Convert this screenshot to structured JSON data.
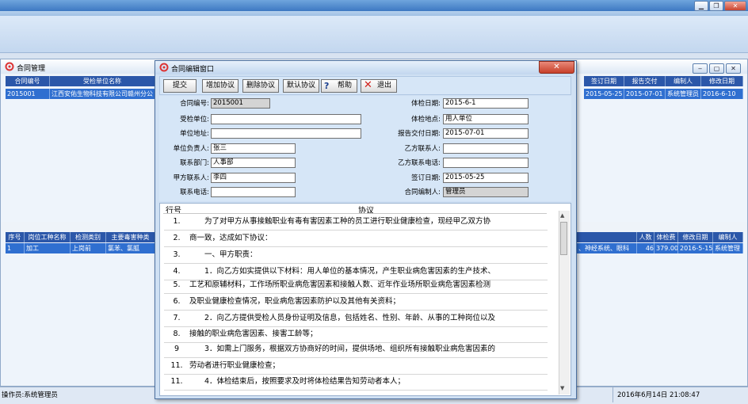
{
  "window": {
    "min": "▁",
    "restore": "❐",
    "close": "✕"
  },
  "main": {
    "title": "合同管理",
    "controls": {
      "min": "‒",
      "restore": "▢",
      "close": "✕"
    },
    "top_grid": {
      "headers": [
        "合同编号",
        "受检单位名称"
      ],
      "right_headers": [
        "签订日期",
        "报告交付",
        "编制人",
        "修改日期"
      ],
      "row": [
        "2015001",
        "江西安佑生物科技有限公司赣州分公"
      ],
      "right_row": [
        "2015-05-25",
        "2015-07-01",
        "系统管理员",
        "2016-6-10"
      ]
    },
    "bottom_grid": {
      "headers": [
        "序号",
        "岗位工种名称",
        "检测类别",
        "主要毒害种类"
      ],
      "right_headers": [
        "人数",
        "体检费",
        "修改日期",
        "编制人"
      ],
      "row": [
        "1",
        "加工",
        "上岗前",
        "氯苯、氯胍"
      ],
      "right_row": [
        "、神经系统、眼科",
        "46",
        "379.00",
        "2016-5-15",
        "系统管理"
      ]
    },
    "status": {
      "operator": "操作员:系统管理员",
      "datetime": "2016年6月14日 21:08:47"
    }
  },
  "dialog": {
    "title": "合同编辑窗口",
    "buttons": [
      "提交",
      "增加协议",
      "删除协议",
      "默认协议",
      "帮助",
      "退出"
    ],
    "form": {
      "contract_no": {
        "label": "合同编号:",
        "value": "2015001"
      },
      "unit": {
        "label": "受检单位:",
        "value": ""
      },
      "address": {
        "label": "单位地址:",
        "value": ""
      },
      "person": {
        "label": "单位负责人:",
        "value": "张三"
      },
      "dept": {
        "label": "联系部门:",
        "value": "人事部"
      },
      "a_contact": {
        "label": "甲方联系人:",
        "value": "李四"
      },
      "phone": {
        "label": "联系电话:",
        "value": ""
      },
      "exam_date": {
        "label": "体检日期:",
        "value": "2015-6-1"
      },
      "exam_place": {
        "label": "体检地点:",
        "value": "用人单位"
      },
      "report_date": {
        "label": "报告交付日期:",
        "value": "2015-07-01"
      },
      "b_contact": {
        "label": "乙方联系人:",
        "value": ""
      },
      "b_phone": {
        "label": "乙方联系电话:",
        "value": ""
      },
      "sign_date": {
        "label": "签订日期:",
        "value": "2015-05-25"
      },
      "author": {
        "label": "合同编制人:",
        "value": "管理员"
      }
    },
    "agreement": {
      "col_no": "行号",
      "col_text": "协议",
      "lines": [
        {
          "no": "1.",
          "text": "　　为了对甲方从事接触职业有毒有害因素工种的员工进行职业健康检查，现经甲乙双方协"
        },
        {
          "no": "2.",
          "text": "商一致，达成如下协议："
        },
        {
          "no": "3.",
          "text": "　　一、甲方职责："
        },
        {
          "no": "4.",
          "text": "　　1．向乙方如实提供以下材料：用人单位的基本情况，产生职业病危害因素的生产技术、"
        },
        {
          "no": "5.",
          "text": "工艺和原辅材料，工作场所职业病危害因素和接触人数、近年作业场所职业病危害因素检测"
        },
        {
          "no": "6.",
          "text": "及职业健康检查情况，职业病危害因素防护以及其他有关资料；"
        },
        {
          "no": "7.",
          "text": "　　2．向乙方提供受检人员身份证明及信息，包括姓名、性别、年龄、从事的工种岗位以及"
        },
        {
          "no": "8.",
          "text": "接触的职业病危害因素、接害工龄等；"
        },
        {
          "no": "9",
          "text": "　　3．如需上门服务，根据双方协商好的时间，提供场地、组织所有接触职业病危害因素的"
        },
        {
          "no": "11.",
          "text": "劳动者进行职业健康检查；"
        },
        {
          "no": "11.",
          "text": "　　4．体检结束后，按照要求及时将体检结果告知劳动者本人；"
        }
      ]
    }
  }
}
